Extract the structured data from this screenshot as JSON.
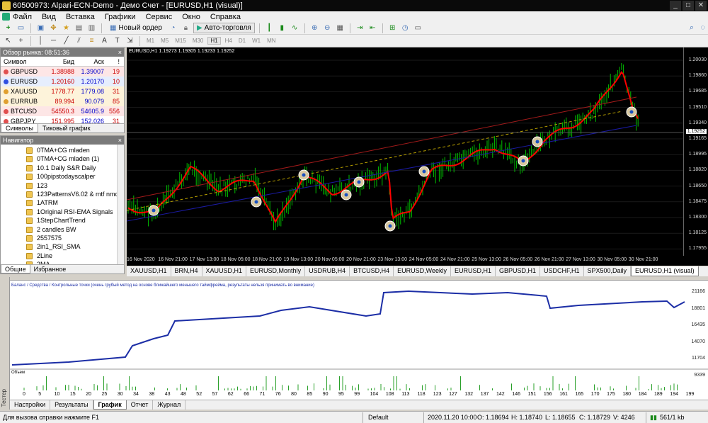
{
  "window": {
    "title": "60500973: Alpari-ECN-Demo - Демо Счет - [EURUSD,H1 (visual)]"
  },
  "menu": [
    "Файл",
    "Вид",
    "Вставка",
    "Графики",
    "Сервис",
    "Окно",
    "Справка"
  ],
  "toolbar": {
    "new_order": "Новый ордер",
    "autotrading": "Авто-торговля"
  },
  "timeframes": [
    "M1",
    "M5",
    "M15",
    "M30",
    "H1",
    "H4",
    "D1",
    "W1",
    "MN"
  ],
  "active_timeframe": "H1",
  "market_watch": {
    "title": "Обзор рынка: 08:51:36",
    "columns": [
      "Символ",
      "Бид",
      "Аск",
      "!"
    ],
    "rows": [
      {
        "symbol": "GBPUSD",
        "bid": "1.38988",
        "ask": "1.39007",
        "spread": "19",
        "color": "#fde6e6",
        "dot": "#e05050"
      },
      {
        "symbol": "EURUSD",
        "bid": "1.20160",
        "ask": "1.20170",
        "spread": "10",
        "color": "#e6eefd",
        "dot": "#3050e0"
      },
      {
        "symbol": "XAUUSD",
        "bid": "1778.77",
        "ask": "1779.08",
        "spread": "31",
        "color": "#fdf3da",
        "dot": "#e0a030"
      },
      {
        "symbol": "EURRUB",
        "bid": "89.994",
        "ask": "90.079",
        "spread": "85",
        "color": "#fdf3da",
        "dot": "#e0a030"
      },
      {
        "symbol": "BTCUSD",
        "bid": "54550.3",
        "ask": "54605.9",
        "spread": "556",
        "color": "#fde6e6",
        "dot": "#e05050"
      },
      {
        "symbol": "GBPJPY",
        "bid": "151.995",
        "ask": "152.026",
        "spread": "31",
        "color": "#fff",
        "dot": "#e05050"
      }
    ],
    "tabs": [
      "Символы",
      "Тиковый график"
    ]
  },
  "navigator": {
    "title": "Навигатор",
    "items": [
      "0TMA+CG mladen",
      "0TMA+CG mladen (1)",
      "10.1 Daily S&R Daily",
      "100pipstodayscalper",
      "123",
      "123PatternsV6.02 & mtf nmc",
      "1ATRM",
      "1Original RSI-EMA Signals",
      "1StepChartTrend",
      "2 candles  BW",
      "2557575",
      "2in1_RSI_SMA",
      "2Line",
      "2MA"
    ],
    "tabs": [
      "Общие",
      "Избранное"
    ]
  },
  "chart": {
    "info": "EURUSD,H1  1.19273 1.19305 1.19233 1.19252",
    "price_labels": [
      "1.20030",
      "1.19860",
      "1.19685",
      "1.19510",
      "1.19340",
      "1.19165",
      "1.18995",
      "1.18820",
      "1.18650",
      "1.18475",
      "1.18300",
      "1.18125",
      "1.17955"
    ],
    "current_price": "1.19252",
    "time_labels": [
      "16 Nov 2020",
      "16 Nov 21:00",
      "17 Nov 13:00",
      "18 Nov 05:00",
      "18 Nov 21:00",
      "19 Nov 13:00",
      "20 Nov 05:00",
      "20 Nov 21:00",
      "23 Nov 13:00",
      "24 Nov 05:00",
      "24 Nov 21:00",
      "25 Nov 13:00",
      "26 Nov 05:00",
      "26 Nov 21:00",
      "27 Nov 13:00",
      "30 Nov 05:00",
      "30 Nov 21:00"
    ]
  },
  "chart_tabs": [
    "XAUUSD,H1",
    "BRN,H4",
    "XAUUSD,H1",
    "EURUSD,Monthly",
    "USDRUB,H4",
    "BTCUSD,H4",
    "EURUSD,Weekly",
    "EURUSD,H1",
    "GBPUSD,H1",
    "USDCHF,H1",
    "SPX500,Daily",
    "EURUSD,H1 (visual)"
  ],
  "tester": {
    "legend": "Баланс / Средства / Контрольные точки (очень грубый метод на основе ближайшего меньшего таймфрейма, результаты нельзя принимать во внимание)",
    "balance_scale": [
      "21166",
      "18801",
      "16435",
      "14070",
      "11704",
      "9339"
    ],
    "volume_label": "Объем",
    "x_labels": [
      "0",
      "5",
      "10",
      "15",
      "20",
      "25",
      "30",
      "34",
      "38",
      "43",
      "48",
      "52",
      "57",
      "62",
      "66",
      "71",
      "76",
      "80",
      "85",
      "90",
      "95",
      "99",
      "104",
      "108",
      "113",
      "118",
      "123",
      "127",
      "132",
      "137",
      "142",
      "146",
      "151",
      "156",
      "161",
      "165",
      "170",
      "175",
      "180",
      "184",
      "189",
      "194",
      "199"
    ],
    "tabs": [
      "Настройки",
      "Результаты",
      "График",
      "Отчет",
      "Журнал"
    ],
    "active_tab": "График",
    "side_label": "Тестер"
  },
  "status": {
    "help": "Для вызова справки нажмите F1",
    "profile": "Default",
    "time": "2020.11.20 10:00",
    "open": "O: 1.18694",
    "high": "H: 1.18740",
    "low": "L: 1.18655",
    "close": "C: 1.18729",
    "volume": "V: 4246",
    "traffic": "561/1 kb"
  },
  "colors": {
    "candle_up": "#00c000",
    "candle_down": "#00c000",
    "signal_line": "#ff0000",
    "balance": "#1c2ea6",
    "background": "#000000"
  }
}
